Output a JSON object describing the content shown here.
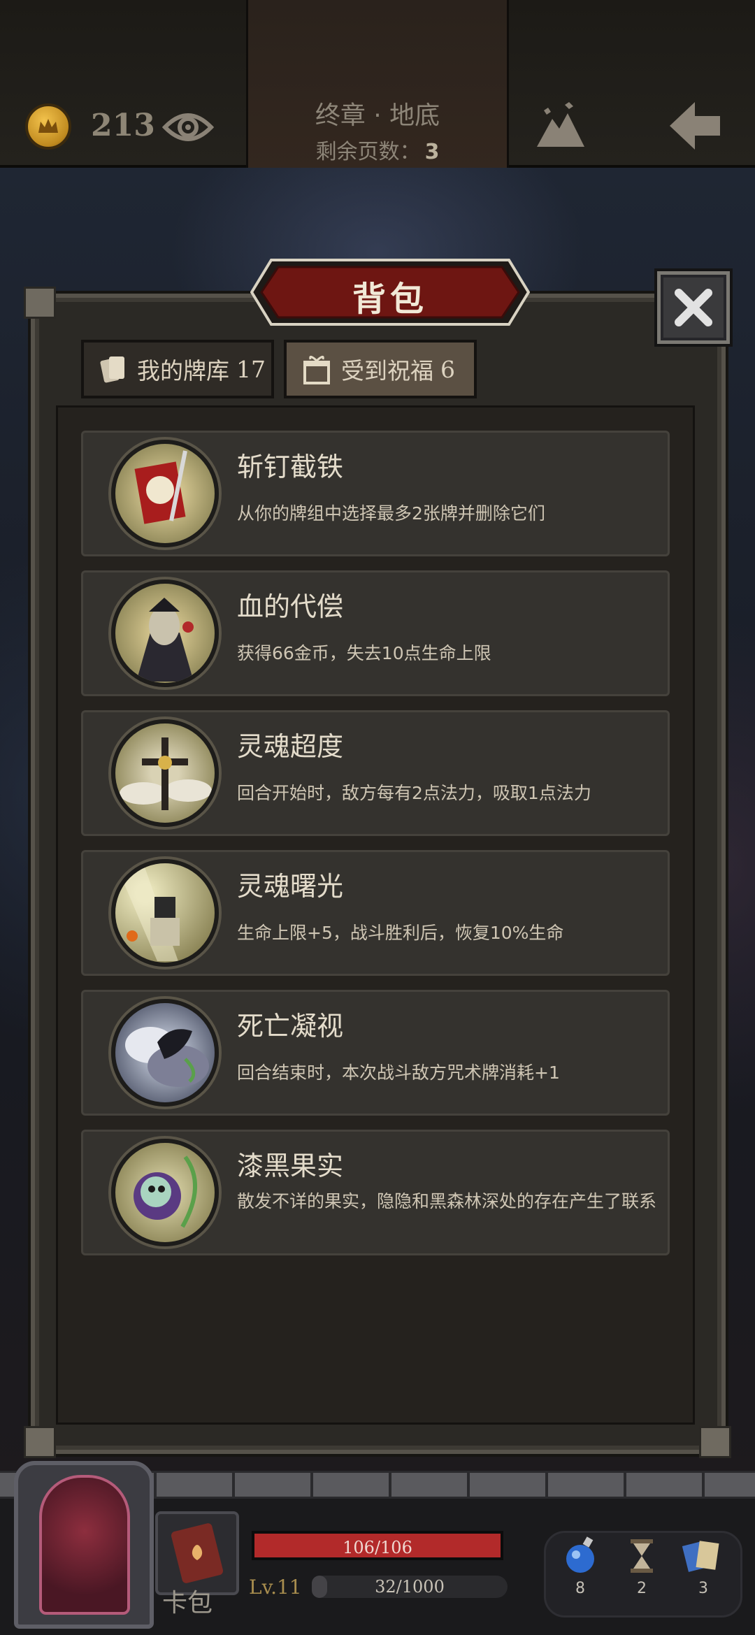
{
  "topbar": {
    "gold": "213",
    "chapter": "终章 · 地底",
    "pages_label": "剩余页数：",
    "pages_value": "3",
    "icons": [
      "crown-coin-icon",
      "eye-icon",
      "mountain-map-icon",
      "back-arrow-icon"
    ]
  },
  "panel": {
    "title": "背包",
    "close_icon": "close-icon",
    "tabs": [
      {
        "label": "我的牌库",
        "count": "17",
        "icon": "cards-icon",
        "active": false
      },
      {
        "label": "受到祝福",
        "count": "6",
        "icon": "gift-icon",
        "active": true
      }
    ]
  },
  "blessings": [
    {
      "name": "斩钉截铁",
      "desc": "从你的牌组中选择最多2张牌并删除它们",
      "icon": "sword-banner-icon"
    },
    {
      "name": "血的代偿",
      "desc": "获得66金币，失去10点生命上限",
      "icon": "vampire-icon"
    },
    {
      "name": "灵魂超度",
      "desc": "回合开始时，敌方每有2点法力，吸取1点法力",
      "icon": "skull-cross-icon"
    },
    {
      "name": "灵魂曙光",
      "desc": "生命上限+5，战斗胜利后，恢复10%生命",
      "icon": "knight-light-icon"
    },
    {
      "name": "死亡凝视",
      "desc": "回合结束时，本次战斗敌方咒术牌消耗+1",
      "icon": "death-cloud-icon"
    },
    {
      "name": "漆黑果实",
      "desc": "散发不详的果实，隐隐和黑森林深处的存在产生了联系",
      "icon": "dark-fruit-icon"
    }
  ],
  "hud": {
    "bag_label": "卡包",
    "hp_text": "106/106",
    "hp_fraction": 1.0,
    "level": "Lv.11",
    "xp_text": "32/1000",
    "xp_fraction": 0.032,
    "resources": [
      {
        "icon": "potion-icon",
        "value": "8"
      },
      {
        "icon": "hourglass-icon",
        "value": "2"
      },
      {
        "icon": "card-stack-icon",
        "value": "3"
      }
    ],
    "colors": {
      "hp": "#b22a2a",
      "level": "#a88d4e"
    }
  }
}
